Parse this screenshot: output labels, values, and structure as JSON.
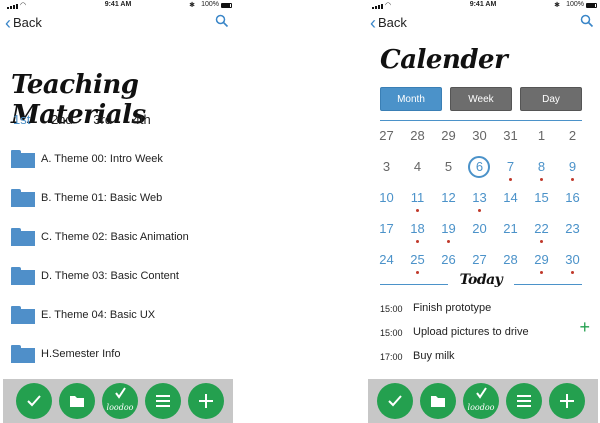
{
  "status": {
    "time": "9:41 AM",
    "battery": "100%"
  },
  "left": {
    "back_label": "Back",
    "title": "Teaching Materials",
    "year_tabs": [
      "1st",
      "2nd",
      "3rd",
      "4th"
    ],
    "active_year": "1st",
    "folders": [
      "A. Theme 00: Intro Week",
      "B. Theme 01: Basic Web",
      "C. Theme 02: Basic Animation",
      "D. Theme 03: Basic Content",
      "E. Theme 04: Basic UX",
      "H.Semester Info"
    ]
  },
  "right": {
    "back_label": "Back",
    "title": "Calender",
    "views": [
      "Month",
      "Week",
      "Day"
    ],
    "active_view": "Month",
    "calendar": {
      "weeks": [
        [
          "27",
          "28",
          "29",
          "30",
          "31",
          "1",
          "2"
        ],
        [
          "3",
          "4",
          "5",
          "6",
          "7",
          "8",
          "9"
        ],
        [
          "10",
          "11",
          "12",
          "13",
          "14",
          "15",
          "16"
        ],
        [
          "17",
          "18",
          "19",
          "20",
          "21",
          "22",
          "23"
        ],
        [
          "24",
          "25",
          "26",
          "27",
          "28",
          "29",
          "30"
        ]
      ],
      "today": "6",
      "event_days": [
        "7",
        "8",
        "9",
        "11",
        "13",
        "18",
        "19",
        "22",
        "25",
        "29",
        "30"
      ]
    },
    "today_heading": "Today",
    "tasks": [
      {
        "time": "15:00",
        "name": "Finish prototype"
      },
      {
        "time": "15:00",
        "name": "Upload pictures to drive"
      },
      {
        "time": "17:00",
        "name": "Buy milk"
      }
    ]
  },
  "toolbar": {
    "buttons": [
      "check-icon",
      "folder-icon",
      "loodoo-logo",
      "menu-icon",
      "plus-icon"
    ],
    "logo_text": "loodoo"
  },
  "colors": {
    "accent": "#4b92c9",
    "green": "#24a04f",
    "toolbar_bg": "#c7c7c7",
    "event_dot": "#c0392b"
  }
}
